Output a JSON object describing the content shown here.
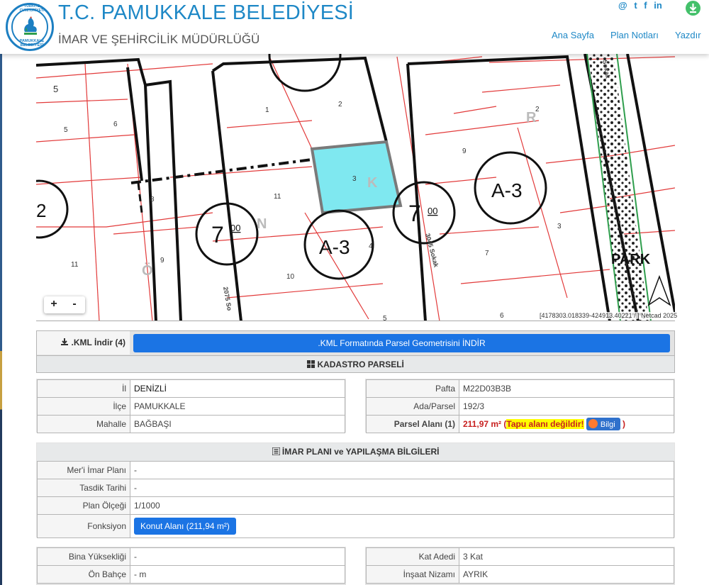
{
  "header": {
    "title": "T.C. PAMUKKALE BELEDİYESİ",
    "subtitle": "İMAR VE ŞEHİRCİLİK MÜDÜRLÜĞÜ",
    "logo_top": "TÜRKİYE CUMHURİYETİ",
    "logo_bottom": "PAMUKKALE BELEDİYESİ",
    "social": [
      "@",
      "t",
      "f",
      "in"
    ],
    "nav": [
      "Ana Sayfa",
      "Plan Notları",
      "Yazdır"
    ]
  },
  "map": {
    "parcel_color": "#7fe8f0",
    "labels": {
      "n1": "1",
      "n2": "2",
      "n3": "3",
      "n4": "4",
      "n5": "5",
      "n5b": "5",
      "n6": "6",
      "n6b": "6",
      "n7": "7",
      "n8": "8",
      "n9": "9",
      "n9b": "9",
      "n10": "10",
      "n11": "11",
      "n11b": "11",
      "n2b": "2",
      "n3b": "3",
      "n4b": "4",
      "n2c": "2"
    },
    "zone_a": "A-3",
    "zone_b": "A-3",
    "code_a": "7",
    "code_a_sup": "00",
    "code_b": "7",
    "code_b_sup": "00",
    "park_label": "PARK",
    "letters": [
      "R",
      "K",
      "Ö",
      "N"
    ],
    "street_a": "3045 Sokak",
    "street_b": "2075 So",
    "street_c": "Sokak",
    "attribution": "[4178303.018339-424913.40221 / ] Netcad 2025",
    "zoom_in": "+",
    "zoom_out": "-"
  },
  "kml": {
    "label": ".KML İndir (4)",
    "button": ".KML Formatında Parsel Geometrisini İNDİR"
  },
  "kadastro": {
    "heading": "KADASTRO PARSELİ",
    "left": [
      {
        "label": "İl",
        "value": "DENİZLİ"
      },
      {
        "label": "İlçe",
        "value": "PAMUKKALE"
      },
      {
        "label": "Mahalle",
        "value": "BAĞBAŞI"
      }
    ],
    "right": [
      {
        "label": "Pafta",
        "value": "M22D03B3B"
      },
      {
        "label": "Ada/Parsel",
        "value": "192/3"
      }
    ],
    "area_label": "Parsel Alanı (1)",
    "area_value": "211,97 m²",
    "area_open": "(",
    "area_warning": "Tapu alanı değildir!",
    "area_info": "Bilgi",
    "area_close": ")"
  },
  "imar": {
    "heading": "İMAR PLANI ve YAPILAŞMA BİLGİLERİ",
    "rows": [
      {
        "label": "Mer'i İmar Planı",
        "value": "-"
      },
      {
        "label": "Tasdik Tarihi",
        "value": "-"
      },
      {
        "label": "Plan Ölçeği",
        "value": "1/1000"
      }
    ],
    "fonksiyon_label": "Fonksiyon",
    "fonksiyon_value": "Konut Alanı (211,94 m²)"
  },
  "yapilasma": {
    "left": [
      {
        "label": "Bina Yüksekliği",
        "value": "-"
      },
      {
        "label": "Ön Bahçe",
        "value": "- m"
      }
    ],
    "right": [
      {
        "label": "Kat Adedi",
        "value": "3 Kat"
      },
      {
        "label": "İnşaat Nizamı",
        "value": "AYRIK"
      }
    ]
  }
}
